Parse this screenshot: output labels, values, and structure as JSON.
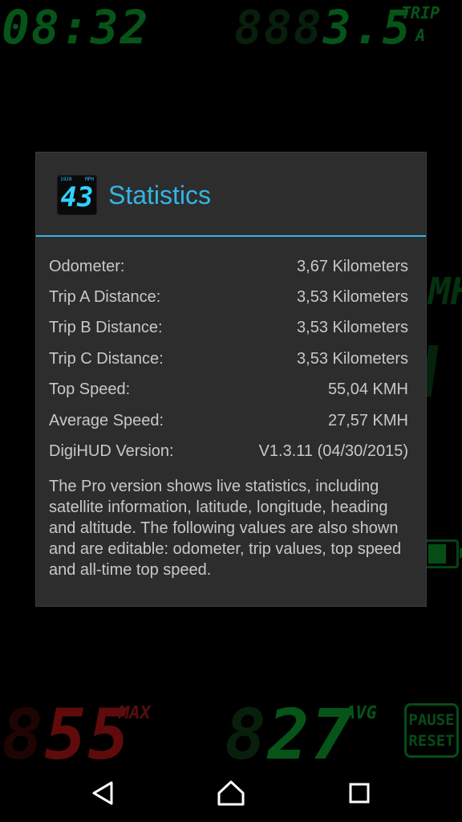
{
  "hud": {
    "clock": "08:32",
    "trip_ghost": "888",
    "trip_value": "3.5",
    "trip_label_line1": "TRIP",
    "trip_label_line2": "A",
    "side_unit_fragment": "MH",
    "max_ghost": "8",
    "max_value": "55",
    "max_label": "MAX",
    "avg_ghost": "8",
    "avg_value": "27",
    "avg_label": "AVG",
    "pause_line1": "PAUSE",
    "pause_line2": "RESET",
    "colors": {
      "green": "#0b9a2d",
      "red": "#b01515",
      "ghost": "#0e3a14"
    }
  },
  "dialog": {
    "icon": {
      "name": "digihud-speed-icon",
      "value": "43",
      "mini_left": "1928",
      "mini_right": "MPH"
    },
    "title": "Statistics",
    "accent": "#33b5e5",
    "rows": [
      {
        "label": "Odometer:",
        "value": "3,67 Kilometers"
      },
      {
        "label": "Trip A Distance:",
        "value": "3,53 Kilometers"
      },
      {
        "label": "Trip B Distance:",
        "value": "3,53 Kilometers"
      },
      {
        "label": "Trip C Distance:",
        "value": "3,53 Kilometers"
      },
      {
        "label": "Top Speed:",
        "value": "55,04 KMH"
      },
      {
        "label": "Average Speed:",
        "value": "27,57 KMH"
      },
      {
        "label": "DigiHUD Version:",
        "value": "V1.3.11 (04/30/2015)"
      }
    ],
    "description": "The Pro version shows live statistics, including satellite information, latitude, longitude, heading and altitude. The following values are also shown and are editable: odometer, trip values, top speed and all-time top speed."
  },
  "navbar": {
    "back_icon": "back-triangle-icon",
    "home_icon": "home-icon",
    "recent_icon": "recent-apps-icon"
  }
}
